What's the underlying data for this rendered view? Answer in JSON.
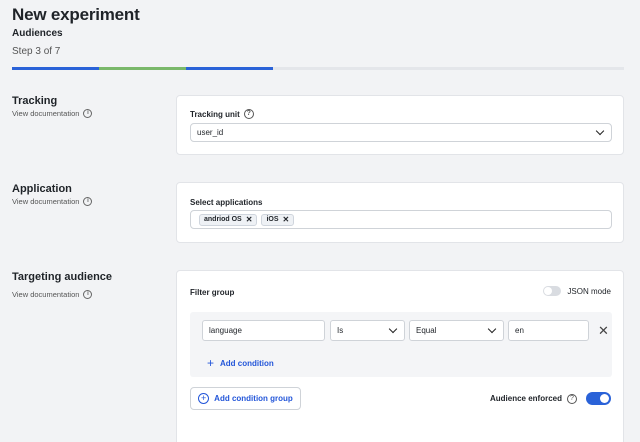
{
  "header": {
    "title": "New experiment",
    "subtitle": "Audiences",
    "step": "Step 3 of 7",
    "progress_segments": [
      "#2a62d8",
      "#7ab86a",
      "#2a62d8"
    ]
  },
  "sections": {
    "tracking": {
      "title": "Tracking",
      "doc_link": "View documentation",
      "field_label": "Tracking unit",
      "field_value": "user_id"
    },
    "application": {
      "title": "Application",
      "doc_link": "View documentation",
      "field_label": "Select applications",
      "tags": [
        "andriod OS",
        "iOS"
      ]
    },
    "targeting": {
      "title": "Targeting audience",
      "doc_link": "View documentation",
      "filter_group_label": "Filter group",
      "json_mode_label": "JSON mode",
      "condition": {
        "attribute": "language",
        "operator": "Is",
        "comparator": "Equal",
        "value": "en"
      },
      "add_condition": "Add condition",
      "add_condition_group": "Add condition group",
      "audience_enforced_label": "Audience enforced",
      "audience_enforced": true
    }
  }
}
